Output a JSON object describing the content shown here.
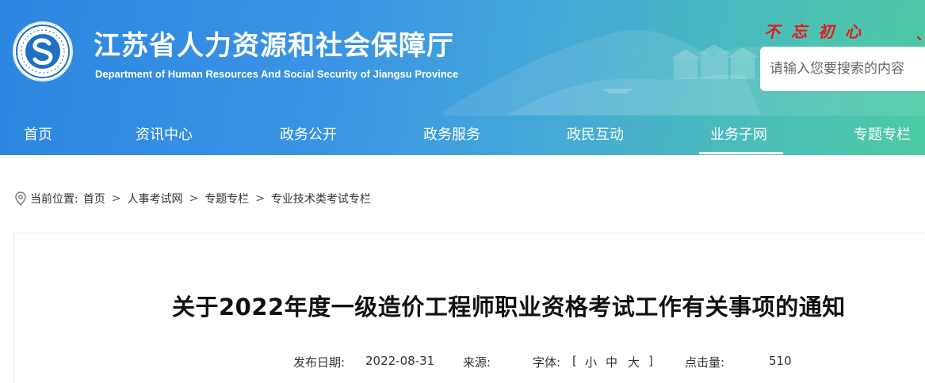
{
  "header": {
    "title": "江苏省人力资源和社会保障厅",
    "subtitle": "Department of Human Resources And Social Security of Jiangsu Province",
    "logo_ring_text": "江苏省人力资源和社会保障厅",
    "slogan": "不忘初心",
    "slogan_tail": "、",
    "search": {
      "placeholder": "请输入您要搜索的内容"
    }
  },
  "nav": {
    "items": [
      {
        "label": "首页"
      },
      {
        "label": "资讯中心"
      },
      {
        "label": "政务公开"
      },
      {
        "label": "政务服务"
      },
      {
        "label": "政民互动"
      },
      {
        "label": "业务子网"
      },
      {
        "label": "专题专栏"
      }
    ],
    "active_index": 5
  },
  "breadcrumb": {
    "prefix": "当前位置:",
    "items": [
      "首页",
      "人事考试网",
      "专题专栏",
      "专业技术类考试专栏"
    ],
    "separator": ">"
  },
  "article": {
    "title": "关于2022年度一级造价工程师职业资格考试工作有关事项的通知",
    "publish_label": "发布日期:",
    "publish_date": "2022-08-31",
    "source_label": "来源:",
    "source_value": "",
    "font_label": "字体:",
    "font_open": "[",
    "font_small": "小",
    "font_medium": "中",
    "font_large": "大",
    "font_close": "]",
    "hits_label": "点击量:",
    "hits_value": "510"
  },
  "colors": {
    "header_gradient_start": "#2c86e0",
    "header_gradient_end": "#4ccaa4",
    "slogan": "#e21b1b"
  }
}
